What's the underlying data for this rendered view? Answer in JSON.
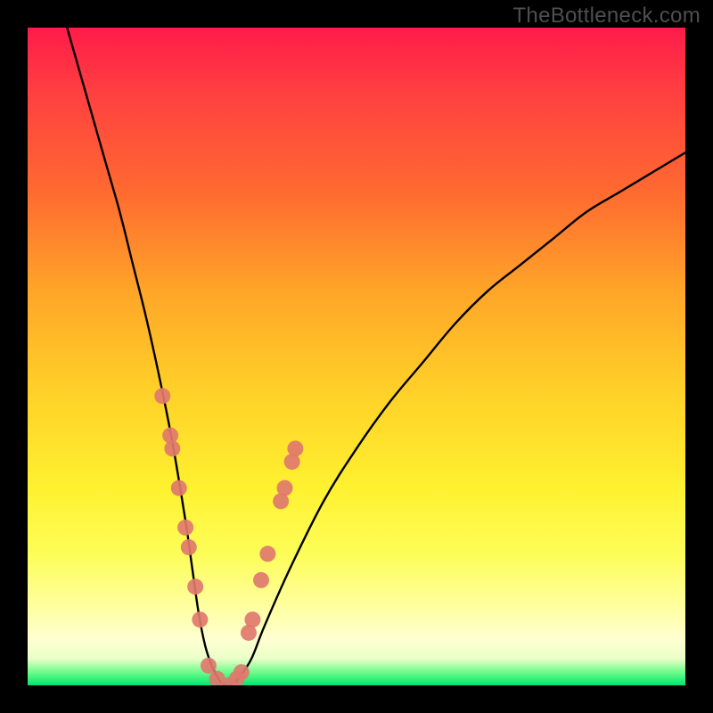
{
  "watermark": "TheBottleneck.com",
  "chart_data": {
    "type": "line",
    "title": "",
    "xlabel": "",
    "ylabel": "",
    "xlim": [
      0,
      100
    ],
    "ylim": [
      0,
      100
    ],
    "series": [
      {
        "name": "bottleneck-curve",
        "x": [
          6,
          8,
          10,
          12,
          14,
          16,
          18,
          20,
          22,
          24,
          25,
          26,
          27,
          28,
          29,
          30,
          31,
          32,
          34,
          36,
          40,
          45,
          50,
          55,
          60,
          65,
          70,
          75,
          80,
          85,
          90,
          95,
          100
        ],
        "y": [
          100,
          93,
          86,
          79,
          72,
          64,
          56,
          47,
          37,
          25,
          18,
          11,
          6,
          3,
          1,
          0,
          0,
          1,
          4,
          9,
          18,
          28,
          36,
          43,
          49,
          55,
          60,
          64,
          68,
          72,
          75,
          78,
          81
        ]
      }
    ],
    "markers": {
      "name": "highlight-points",
      "color": "#e0786e",
      "points": [
        {
          "x": 20.5,
          "y": 44
        },
        {
          "x": 21.7,
          "y": 38
        },
        {
          "x": 22.0,
          "y": 36
        },
        {
          "x": 23.0,
          "y": 30
        },
        {
          "x": 24.0,
          "y": 24
        },
        {
          "x": 24.5,
          "y": 21
        },
        {
          "x": 25.5,
          "y": 15
        },
        {
          "x": 26.2,
          "y": 10
        },
        {
          "x": 27.5,
          "y": 3
        },
        {
          "x": 28.8,
          "y": 1
        },
        {
          "x": 30.5,
          "y": 0
        },
        {
          "x": 31.8,
          "y": 1
        },
        {
          "x": 32.5,
          "y": 2
        },
        {
          "x": 33.6,
          "y": 8
        },
        {
          "x": 34.2,
          "y": 10
        },
        {
          "x": 35.5,
          "y": 16
        },
        {
          "x": 36.5,
          "y": 20
        },
        {
          "x": 38.5,
          "y": 28
        },
        {
          "x": 39.1,
          "y": 30
        },
        {
          "x": 40.2,
          "y": 34
        },
        {
          "x": 40.7,
          "y": 36
        }
      ]
    },
    "gradient_stops": [
      {
        "pos": 0,
        "color": "#ff1b4a"
      },
      {
        "pos": 25,
        "color": "#ff6a30"
      },
      {
        "pos": 55,
        "color": "#ffd028"
      },
      {
        "pos": 80,
        "color": "#fdfd58"
      },
      {
        "pos": 96,
        "color": "#e9ffc8"
      },
      {
        "pos": 100,
        "color": "#00e56e"
      }
    ]
  }
}
